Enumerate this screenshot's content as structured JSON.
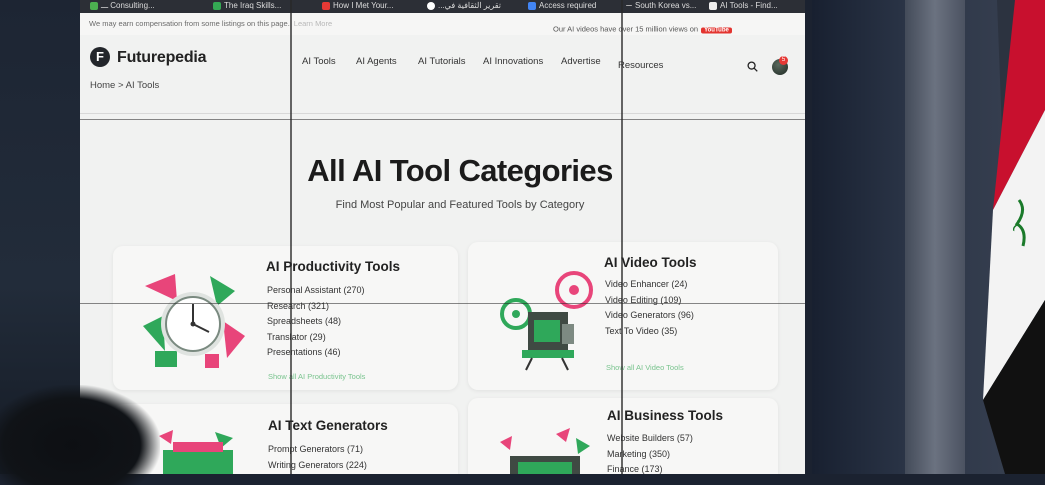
{
  "browser_tabs": [
    {
      "label": "ـــ Consulting...",
      "icon_color": "#4caf50"
    },
    {
      "label": "The Iraq Skills...",
      "icon_color": "#34a853"
    },
    {
      "label": "How I Met Your...",
      "icon_color": "#e53935"
    },
    {
      "label": "...تقرير الثقافية في",
      "icon_color": "#ffffff"
    },
    {
      "label": "Access required",
      "icon_color": "#4285f4"
    },
    {
      "label": "South Korea vs...",
      "icon_color": "#9e9e9e"
    },
    {
      "label": "AI Tools - Find...",
      "icon_color": "#eeeeee"
    }
  ],
  "notice": {
    "compensation_text": "We may earn compensation from some listings on this page.",
    "learn_more": "Learn More",
    "views_text": "Our AI videos have over 15 million views on",
    "youtube_label": "YouTube"
  },
  "header": {
    "logo_letter": "F",
    "logo_text": "Futurepedia",
    "nav_items": [
      "AI Tools",
      "AI Agents",
      "AI Tutorials",
      "AI Innovations",
      "Advertise",
      "Resources"
    ],
    "search_icon": "search-icon",
    "notification_count": "5"
  },
  "breadcrumb": "Home  > AI Tools",
  "page": {
    "title": "All AI Tool Categories",
    "subtitle": "Find Most Popular and Featured Tools by Category"
  },
  "categories": [
    {
      "title": "AI Productivity Tools",
      "items": [
        "Personal Assistant (270)",
        "Research (321)",
        "Spreadsheets (48)",
        "Translator (29)",
        "Presentations (46)"
      ],
      "show_all": "Show all AI Productivity Tools",
      "illustration": "clock-illustration"
    },
    {
      "title": "AI Video Tools",
      "items": [
        "Video Enhancer (24)",
        "Video Editing (109)",
        "Video Generators (96)",
        "Text To Video (35)"
      ],
      "show_all": "Show all AI Video Tools",
      "illustration": "projector-illustration"
    },
    {
      "title": "AI Text Generators",
      "items": [
        "Prompt Generators (71)",
        "Writing Generators (224)"
      ],
      "illustration": "typewriter-illustration"
    },
    {
      "title": "AI Business Tools",
      "items": [
        "Website Builders (57)",
        "Marketing (350)",
        "Finance (173)"
      ],
      "illustration": "briefcase-illustration"
    }
  ],
  "colors": {
    "accent_green": "#79c48e",
    "illustration_green": "#2fa85a",
    "illustration_pink": "#e8457a",
    "badge_red": "#e53935"
  }
}
